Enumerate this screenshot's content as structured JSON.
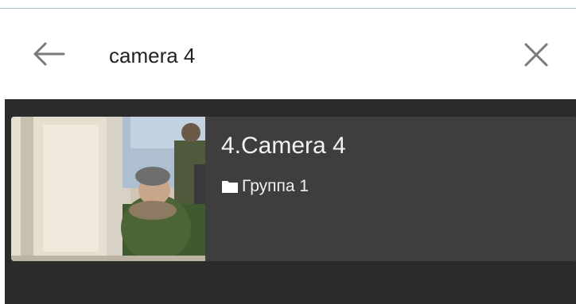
{
  "search": {
    "query": "camera 4",
    "back_icon": "arrow-left-icon",
    "clear_icon": "close-icon"
  },
  "results": [
    {
      "name": "4.Camera 4",
      "group": "Группа 1",
      "group_icon": "folder-icon",
      "thumbnail": "camera-snapshot"
    }
  ],
  "colors": {
    "background_dark": "#2b2b2b",
    "card": "#3e3e3e",
    "text_light": "#f2f2f2",
    "icon_gray": "#7a7a7a"
  }
}
